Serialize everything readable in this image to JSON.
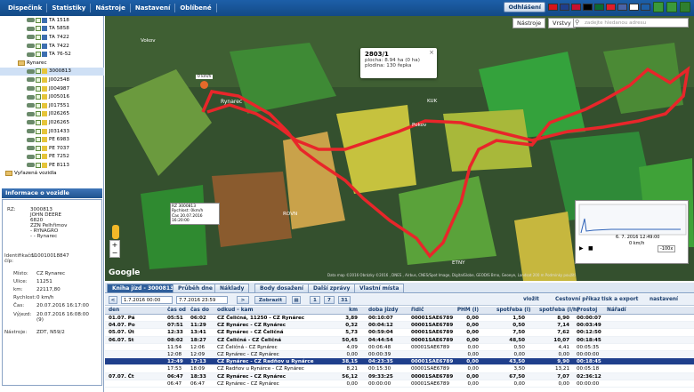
{
  "menu": [
    "Dispečink",
    "Statistiky",
    "Nástroje",
    "Nastavení",
    "Oblíbené"
  ],
  "logout_label": "Odhlášení",
  "flags": [
    "#d7141a",
    "#1f3f8c",
    "#c8102e",
    "#000000",
    "#0a6b32",
    "#e11d2a",
    "#4a64a8",
    "#ffffff",
    "#1d5fa8"
  ],
  "tree": [
    {
      "label": "TA 1518",
      "type": "car"
    },
    {
      "label": "TA 5858",
      "type": "car"
    },
    {
      "label": "TA 7422",
      "type": "car"
    },
    {
      "label": "TA 7422",
      "type": "car"
    },
    {
      "label": "TA 76-52",
      "type": "car"
    },
    {
      "label": "Rynarec",
      "type": "folder"
    },
    {
      "label": "3000813",
      "type": "car",
      "selected": true
    },
    {
      "label": "J002548",
      "type": "car"
    },
    {
      "label": "J004987",
      "type": "car"
    },
    {
      "label": "J005016",
      "type": "car"
    },
    {
      "label": "J017551",
      "type": "car"
    },
    {
      "label": "J026265",
      "type": "car"
    },
    {
      "label": "J026265",
      "type": "car"
    },
    {
      "label": "J031433",
      "type": "car"
    },
    {
      "label": "PE 6983",
      "type": "car"
    },
    {
      "label": "PE 7037",
      "type": "car"
    },
    {
      "label": "PE 7252",
      "type": "car"
    },
    {
      "label": "PE 8113",
      "type": "car"
    },
    {
      "label": "Vyřazená vozidla",
      "type": "folder"
    }
  ],
  "info": {
    "title": "Informace o vozidle",
    "rz_label": "RZ:",
    "rz_value": "3000813\nJOHN DEERE\n6820\nZZN Pelhřimov\n- RYNAGRO\n- - Rynarec",
    "ident_label": "Identifikační číp:",
    "ident_value": "110010018847",
    "place_label": "Místo:",
    "place_value": "CZ Rynarec",
    "street_label": "Ulice:",
    "street_value": "11251",
    "km_label": "km:",
    "km_value": "22117,80",
    "speed_label": "Rychlost:",
    "speed_value": "0 km/h",
    "time_label": "Čas:",
    "time_value": "20.07.2016 16:17:00",
    "exit_label": "Výjezd:",
    "exit_value": "20.07.2016 16:08:00\n(9)",
    "tools_label": "Nástroje:",
    "tools_value": "ZDT, N59/2"
  },
  "map": {
    "tools_btn": "Nástroje",
    "layers_btn": "Vrstvy",
    "search_placeholder": "zadejte hledanou adresu",
    "popup_title": "2803/1",
    "popup_line1": "plocha: 8.94 ha (0 ha)",
    "popup_line2": "plodina: 130 řepka",
    "marker_label": "0 km/h",
    "tooltip_text": "RZ 3000813\nRychlost: 0km/h\nČas 20.07.2016 16:20:00",
    "place_rynarec": "Rynarec",
    "place_pokov": "Pokov",
    "place_vokov": "Vokov",
    "place_rovn": "ROVN",
    "place_etny": "ETNY",
    "place_kuk": "KUK",
    "google": "Google",
    "attribution": "Data map ©2016  Obrázky ©2016 , DNES , Airbus, CNES/Spot Image, DigitalGlobe, GEODIS Brno, Geoeye, Landsat  200 m  Podmínky použití",
    "speed_time": "6. 7. 2016 12:49:00",
    "speed_value": "0 km/h"
  },
  "tabs": [
    "Kniha jízd - 3000813",
    "Průběh dne",
    "Náklady",
    "Body dosažení",
    "Další zprávy",
    "Vlastní místa"
  ],
  "controls": {
    "date_from": "1.7.2016 00:00",
    "date_to": "7.7.2016 23:59",
    "show": "Zobrazit",
    "p1": "1",
    "p7": "7",
    "p31": "31",
    "links": [
      "vložit",
      "Cestovní příkaz",
      "tisk a export",
      "nastavení"
    ]
  },
  "grid": {
    "headers": [
      "den",
      "čas od",
      "čas do",
      "odkud - kam",
      "km",
      "doba jízdy",
      "řidič",
      "PHM (l)",
      "spotřeba (l)",
      "spotřeba (l/h)",
      "Prostoj",
      "Nářadí"
    ],
    "rows": [
      {
        "cls": "bold",
        "day": "01.07. Pá",
        "from": "05:51",
        "to": "06:02",
        "route": "CZ Čeličná, 11250 - CZ Rynárec",
        "km": "3,89",
        "dur": "00:10:07",
        "drv": "00001SAE6789",
        "phm": "0,00",
        "sp": "1,50",
        "sph": "8,90",
        "idle": "00:00:07"
      },
      {
        "cls": "bold alt",
        "day": "04.07. Po",
        "from": "07:51",
        "to": "11:29",
        "route": "CZ Rynárec - CZ Rynárec",
        "km": "0,32",
        "dur": "00:04:12",
        "drv": "00001SAE6789",
        "phm": "0,00",
        "sp": "0,50",
        "sph": "7,14",
        "idle": "00:03:49"
      },
      {
        "cls": "bold",
        "day": "05.07. Út",
        "from": "12:33",
        "to": "13:41",
        "route": "CZ Rynárec - CZ Čeličná",
        "km": "5,73",
        "dur": "00:59:04",
        "drv": "00001SAE6789",
        "phm": "0,00",
        "sp": "7,50",
        "sph": "7,62",
        "idle": "00:12:50"
      },
      {
        "cls": "bold alt",
        "day": "06.07. St",
        "from": "08:02",
        "to": "18:27",
        "route": "CZ Čeličná - CZ Čeličná",
        "km": "50,45",
        "dur": "04:44:54",
        "drv": "00001SAE6789",
        "phm": "0,00",
        "sp": "48,50",
        "sph": "10,07",
        "idle": "00:18:45"
      },
      {
        "cls": "",
        "day": "",
        "from": "11:54",
        "to": "12:06",
        "route": "CZ Čeličná - CZ Rynárec",
        "km": "4,09",
        "dur": "00:06:48",
        "drv": "00001SAE6789",
        "phm": "0,00",
        "sp": "0,50",
        "sph": "4,41",
        "idle": "00:05:35"
      },
      {
        "cls": "alt",
        "day": "",
        "from": "12:08",
        "to": "12:09",
        "route": "CZ Rynárec - CZ Rynárec",
        "km": "0,00",
        "dur": "00:00:39",
        "drv": "",
        "phm": "0,00",
        "sp": "0,00",
        "sph": "0,00",
        "idle": "00:00:00"
      },
      {
        "cls": "sel",
        "day": "",
        "from": "12:49",
        "to": "17:13",
        "route": "CZ Rynárec - CZ Radňov u Rynárce",
        "km": "38,15",
        "dur": "04:23:35",
        "drv": "00001SAE6789",
        "phm": "0,00",
        "sp": "43,50",
        "sph": "9,90",
        "idle": "00:18:45"
      },
      {
        "cls": "",
        "day": "",
        "from": "17:53",
        "to": "18:09",
        "route": "CZ Radňov u Rynárce - CZ Rynárec",
        "km": "8,21",
        "dur": "00:15:30",
        "drv": "00001SAE6789",
        "phm": "0,00",
        "sp": "3,50",
        "sph": "13,21",
        "idle": "00:05:18"
      },
      {
        "cls": "bold alt",
        "day": "07.07. Čt",
        "from": "06:47",
        "to": "18:33",
        "route": "CZ Rynárec - CZ Rynárec",
        "km": "56,12",
        "dur": "09:33:25",
        "drv": "00001SAE6789",
        "phm": "0,00",
        "sp": "67,50",
        "sph": "7,07",
        "idle": "02:36:12"
      },
      {
        "cls": "",
        "day": "",
        "from": "06:47",
        "to": "06:47",
        "route": "CZ Rynárec - CZ Rynárec",
        "km": "0,00",
        "dur": "00:00:00",
        "drv": "00001SAE6789",
        "phm": "0,00",
        "sp": "0,00",
        "sph": "0,00",
        "idle": "00:00:00"
      }
    ]
  }
}
